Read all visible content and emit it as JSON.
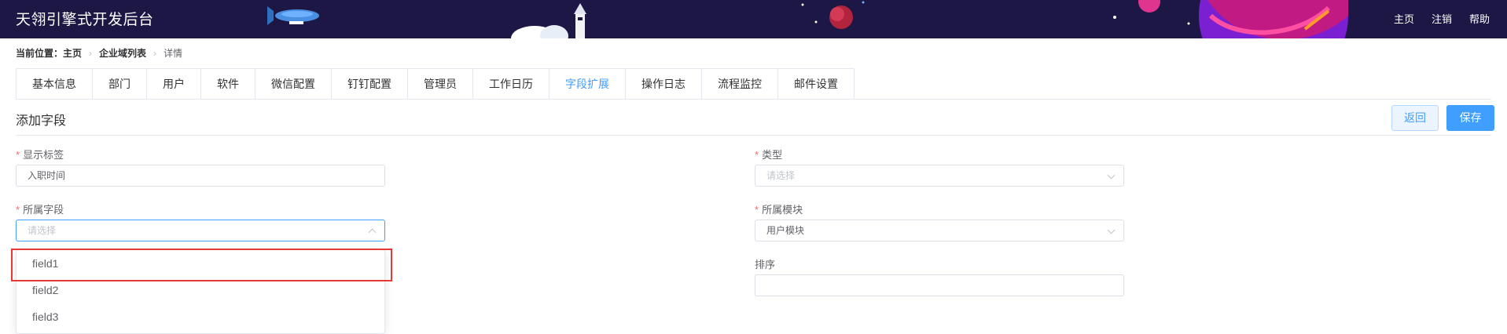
{
  "header": {
    "title": "天翎引擎式开发后台",
    "nav": [
      "主页",
      "注销",
      "帮助"
    ]
  },
  "breadcrumb": {
    "label": "当前位置：",
    "home": "主页",
    "list": "企业域列表",
    "current": "详情"
  },
  "tabs": [
    {
      "label": "基本信息"
    },
    {
      "label": "部门"
    },
    {
      "label": "用户"
    },
    {
      "label": "软件"
    },
    {
      "label": "微信配置"
    },
    {
      "label": "钉钉配置"
    },
    {
      "label": "管理员"
    },
    {
      "label": "工作日历"
    },
    {
      "label": "字段扩展",
      "active": true
    },
    {
      "label": "操作日志"
    },
    {
      "label": "流程监控"
    },
    {
      "label": "邮件设置"
    }
  ],
  "section": {
    "title": "添加字段",
    "back_label": "返回",
    "save_label": "保存"
  },
  "form": {
    "display_label": {
      "label": "显示标签",
      "value": "入职时间"
    },
    "type": {
      "label": "类型",
      "placeholder": "请选择"
    },
    "field": {
      "label": "所属字段",
      "placeholder": "请选择"
    },
    "module": {
      "label": "所属模块",
      "value": "用户模块"
    },
    "order": {
      "label": "排序",
      "value": ""
    }
  },
  "dropdown": {
    "options": [
      "field1",
      "field2",
      "field3"
    ]
  },
  "colors": {
    "header_bg": "#1c1744",
    "accent": "#409eff",
    "required": "#f56c6c",
    "highlight": "#e53935"
  }
}
